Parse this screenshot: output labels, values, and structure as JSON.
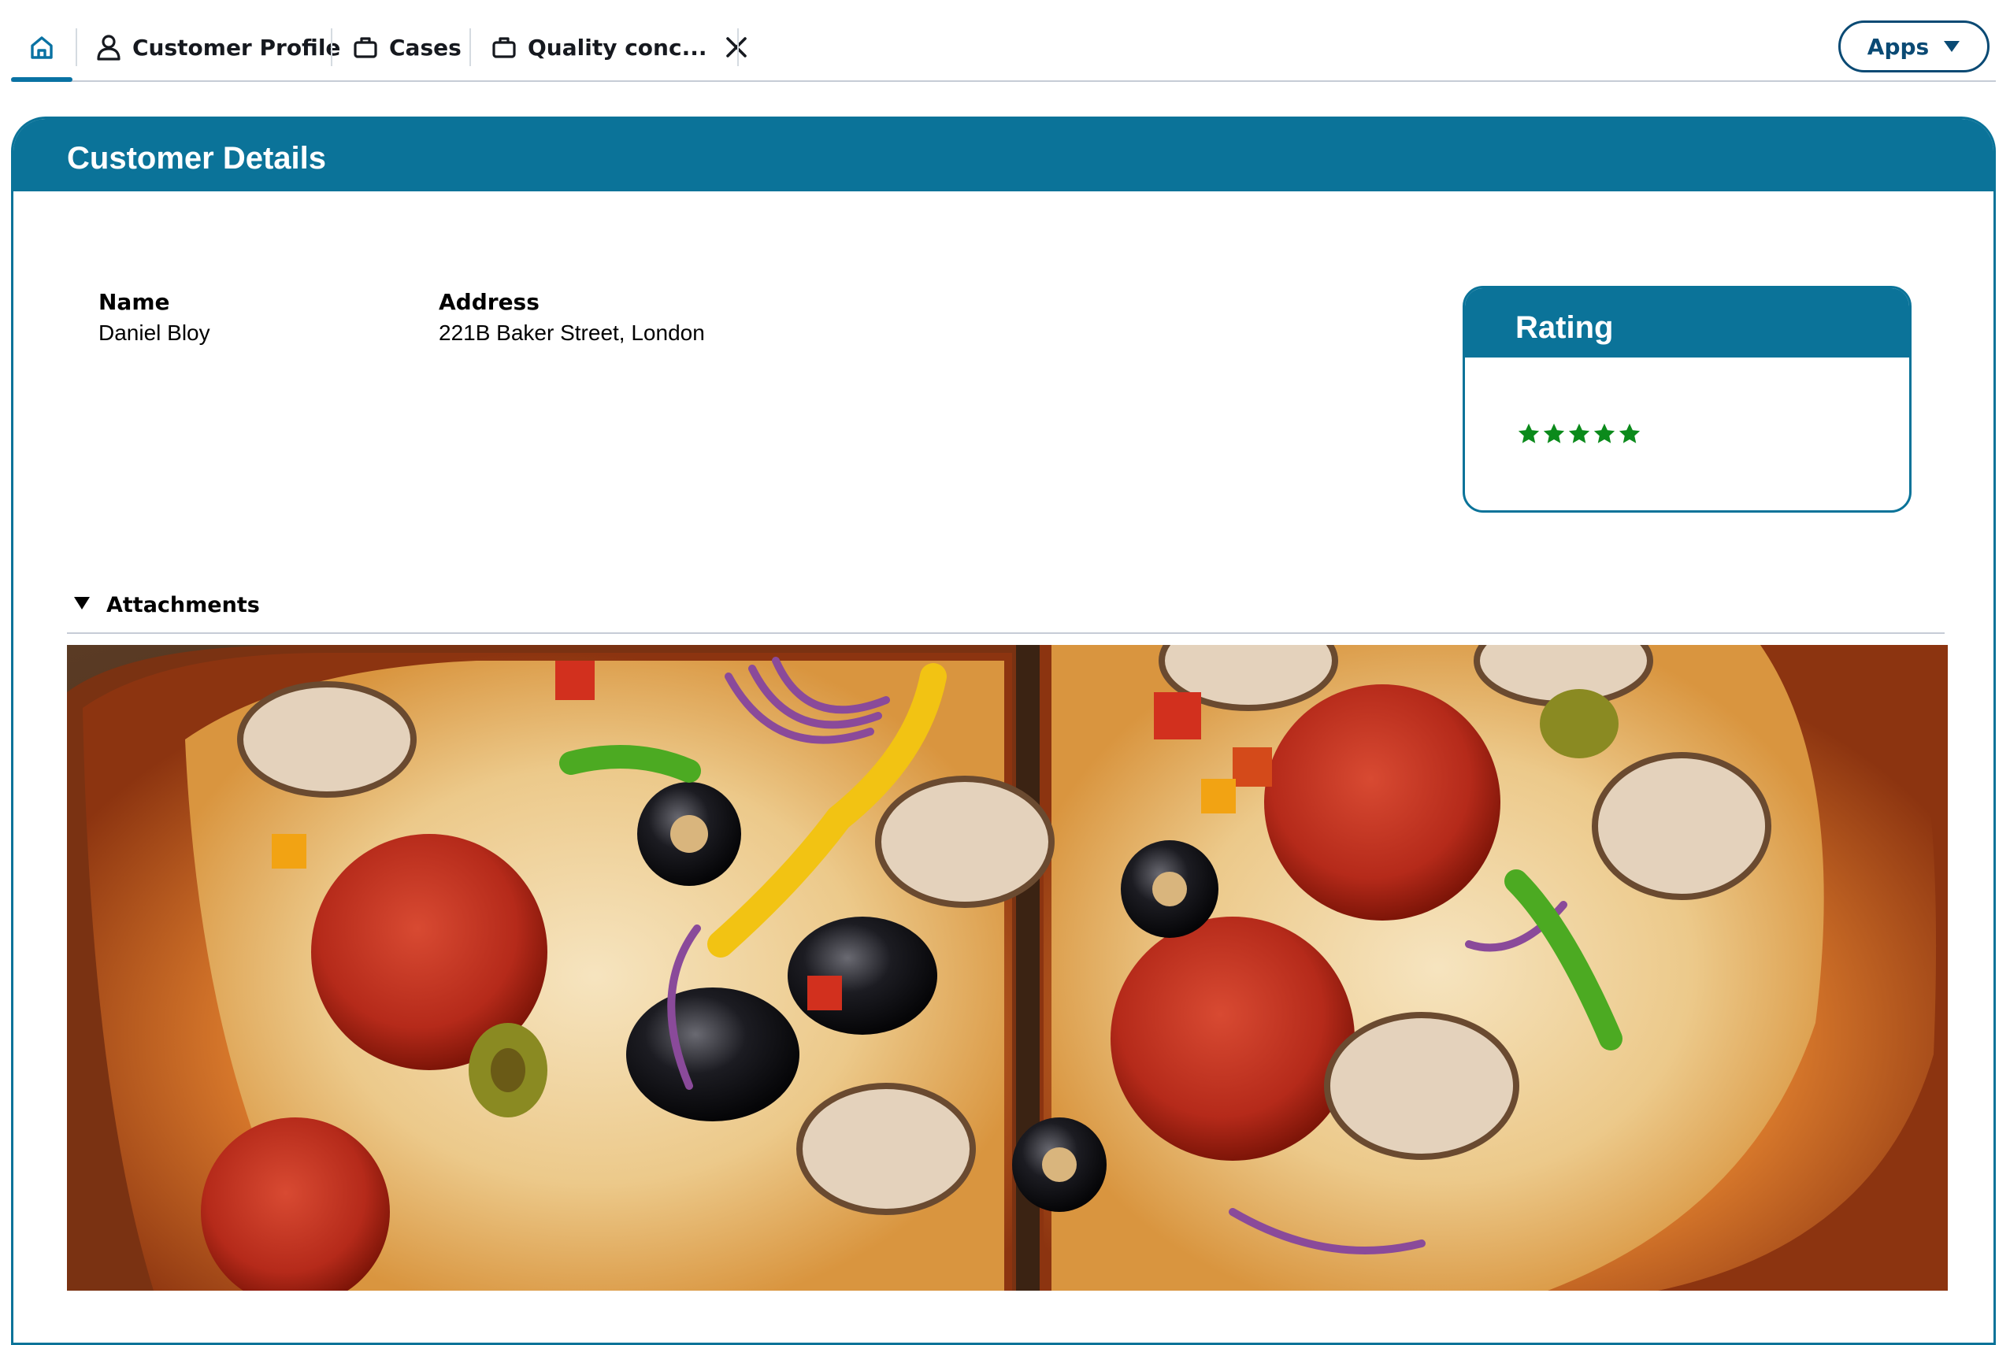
{
  "tabs": {
    "home": {
      "icon": "home-icon"
    },
    "profile": {
      "label": "Customer Profile",
      "icon": "user-icon"
    },
    "cases": {
      "label": "Cases",
      "icon": "briefcase-icon"
    },
    "quality": {
      "label": "Quality conc...",
      "icon": "briefcase-icon",
      "close_icon": "close-icon"
    }
  },
  "apps_button": {
    "label": "Apps",
    "icon": "caret-down-icon"
  },
  "customer_details": {
    "title": "Customer Details",
    "name_label": "Name",
    "name_value": "Daniel Bloy",
    "address_label": "Address",
    "address_value": "221B Baker Street, London"
  },
  "rating": {
    "title": "Rating",
    "stars": 5,
    "max_stars": 5,
    "star_color": "#0b8a1b"
  },
  "attachments": {
    "label": "Attachments",
    "expanded": true,
    "image_alt": "Photo of a pizza cut in half with pepperoni, mushrooms, olives, onions and peppers"
  },
  "colors": {
    "brand": "#0b7399",
    "accent_dark": "#0a4a74",
    "text": "#16191f"
  }
}
